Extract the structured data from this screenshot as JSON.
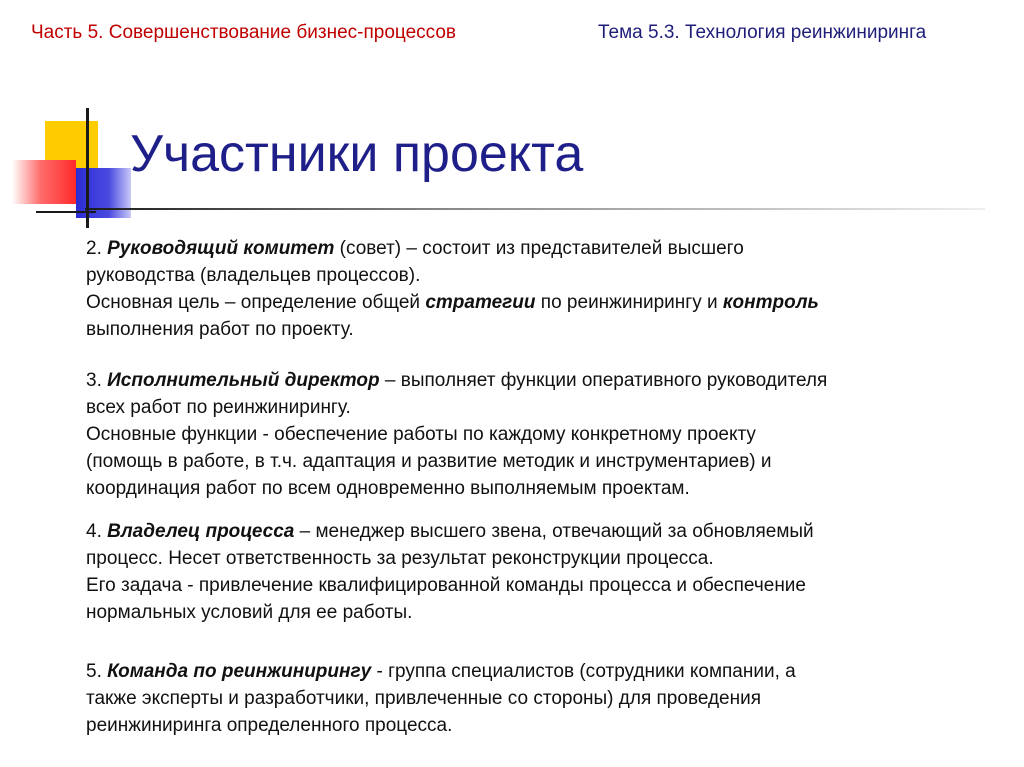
{
  "header": {
    "left": "Часть 5. Совершенствование бизнес-процессов",
    "right": "Тема 5.3. Технология реинжиниринга"
  },
  "title": "Участники проекта",
  "colors": {
    "header_left": "#c00000",
    "header_right": "#1f1f7a",
    "title": "#1f1f8a",
    "deco_yellow": "#ffcc00",
    "deco_red": "#ff2a2a",
    "deco_blue": "#2c2cd4"
  },
  "items": [
    {
      "num": "2. ",
      "term": "Руководящий комитет",
      "l1": " (совет) – состоит из представителей высшего",
      "l2": "руководства (владельцев процессов).",
      "l3a": "Основная цель – определение общей ",
      "l3b": "стратегии",
      "l3c": " по реинжинирингу и ",
      "l3d": "контроль",
      "l4": "выполнения работ по проекту."
    },
    {
      "num": "3. ",
      "term": "Исполнительный директор",
      "l1": " – выполняет функции оперативного руководителя",
      "l2": "всех работ по реинжинирингу.",
      "l3": "Основные функции - обеспечение работы по каждому конкретному проекту",
      "l4": "(помощь в работе, в т.ч. адаптация и развитие методик и инструментариев) и",
      "l5": "координация работ по всем одновременно выполняемым проектам."
    },
    {
      "num": "4. ",
      "term": "Владелец процесса",
      "l1": " – менеджер высшего звена, отвечающий за обновляемый",
      "l2": "процесс. Несет ответственность за результат реконструкции процесса.",
      "l3": "Его задача - привлечение квалифицированной команды процесса и обеспечение",
      "l4": "нормальных условий для ее работы."
    },
    {
      "num": "5. ",
      "term": "Команда по реинжинирингу",
      "l1": " - группа специалистов (сотрудники компании, а",
      "l2": "также эксперты и разработчики, привлеченные со стороны) для проведения",
      "l3": "реинжиниринга определенного процесса."
    }
  ]
}
